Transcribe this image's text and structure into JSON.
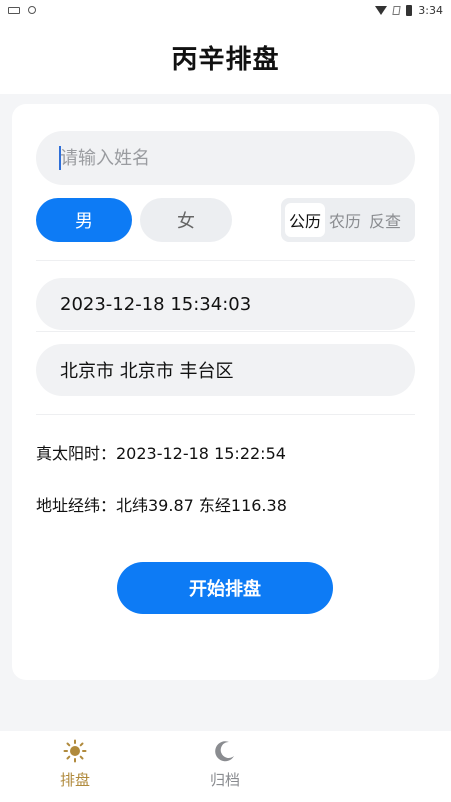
{
  "status_bar": {
    "time": "3:34"
  },
  "header": {
    "title": "丙辛排盘"
  },
  "form": {
    "name_placeholder": "请输入姓名",
    "gender": {
      "male": "男",
      "female": "女",
      "selected": "男"
    },
    "calendar": {
      "options": [
        "公历",
        "农历",
        "反查"
      ],
      "selected": "公历"
    },
    "datetime": "2023-12-18 15:34:03",
    "location": "北京市  北京市  丰台区",
    "true_solar_time": "真太阳时：2023-12-18 15:22:54",
    "coordinates": "地址经纬：北纬39.87  东经116.38",
    "start_button": "开始排盘"
  },
  "bottom_nav": {
    "items": [
      {
        "label": "排盘",
        "icon": "sun-icon",
        "active": true
      },
      {
        "label": "归档",
        "icon": "moon-icon",
        "active": false
      }
    ],
    "active_color": "#b08a3c"
  },
  "colors": {
    "accent": "#0d7bf5"
  }
}
